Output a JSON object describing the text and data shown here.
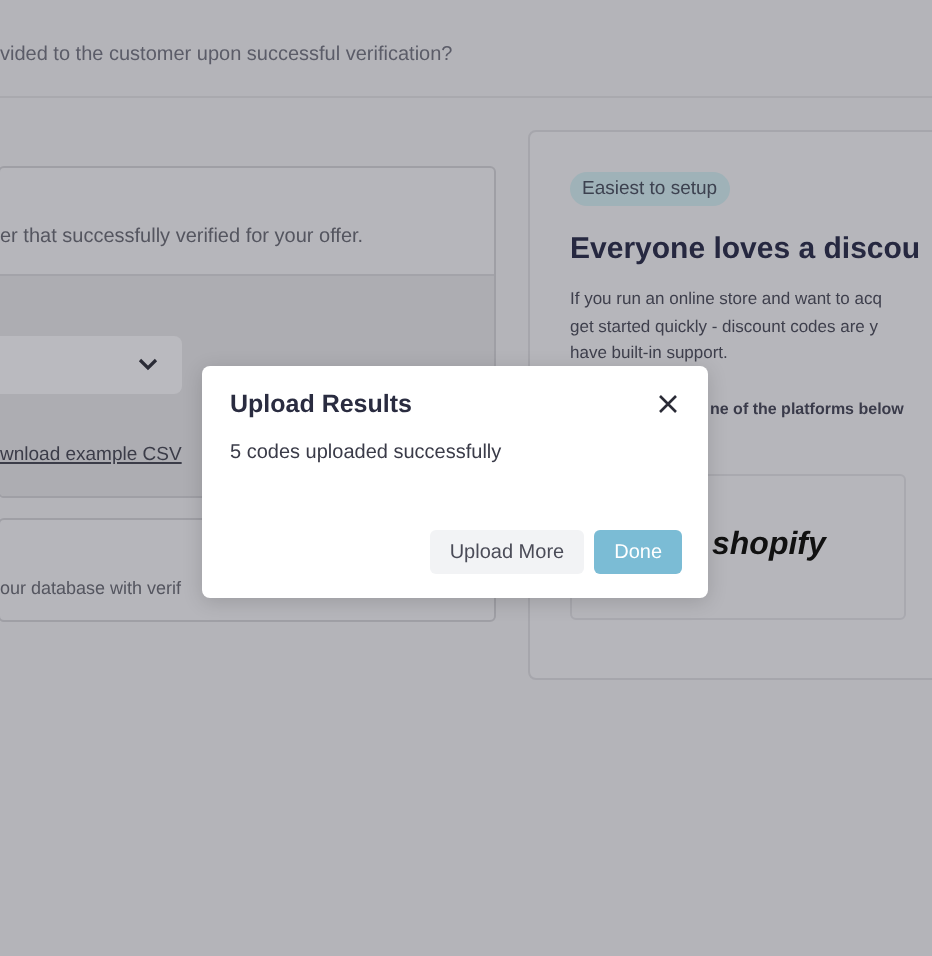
{
  "question_text": "vided to the customer upon successful verification?",
  "offer_card": {
    "description": "er that successfully verified for your offer.",
    "download_link": "wnload example CSV"
  },
  "database_card": {
    "text": "our database with verif"
  },
  "discount_card": {
    "badge": "Easiest to setup",
    "title": "Everyone loves a discou",
    "paragraph_lines": [
      "If you run an online store and want to acq",
      "get started quickly - discount codes are y",
      "have built-in support."
    ],
    "platforms_prompt": "ne of the platforms below",
    "platforms": [
      {
        "name": "shopify"
      }
    ]
  },
  "dialog": {
    "title": "Upload Results",
    "message": "5 codes uploaded successfully",
    "buttons": [
      {
        "label": "Upload More",
        "kind": "secondary"
      },
      {
        "label": "Done",
        "kind": "primary"
      }
    ]
  }
}
